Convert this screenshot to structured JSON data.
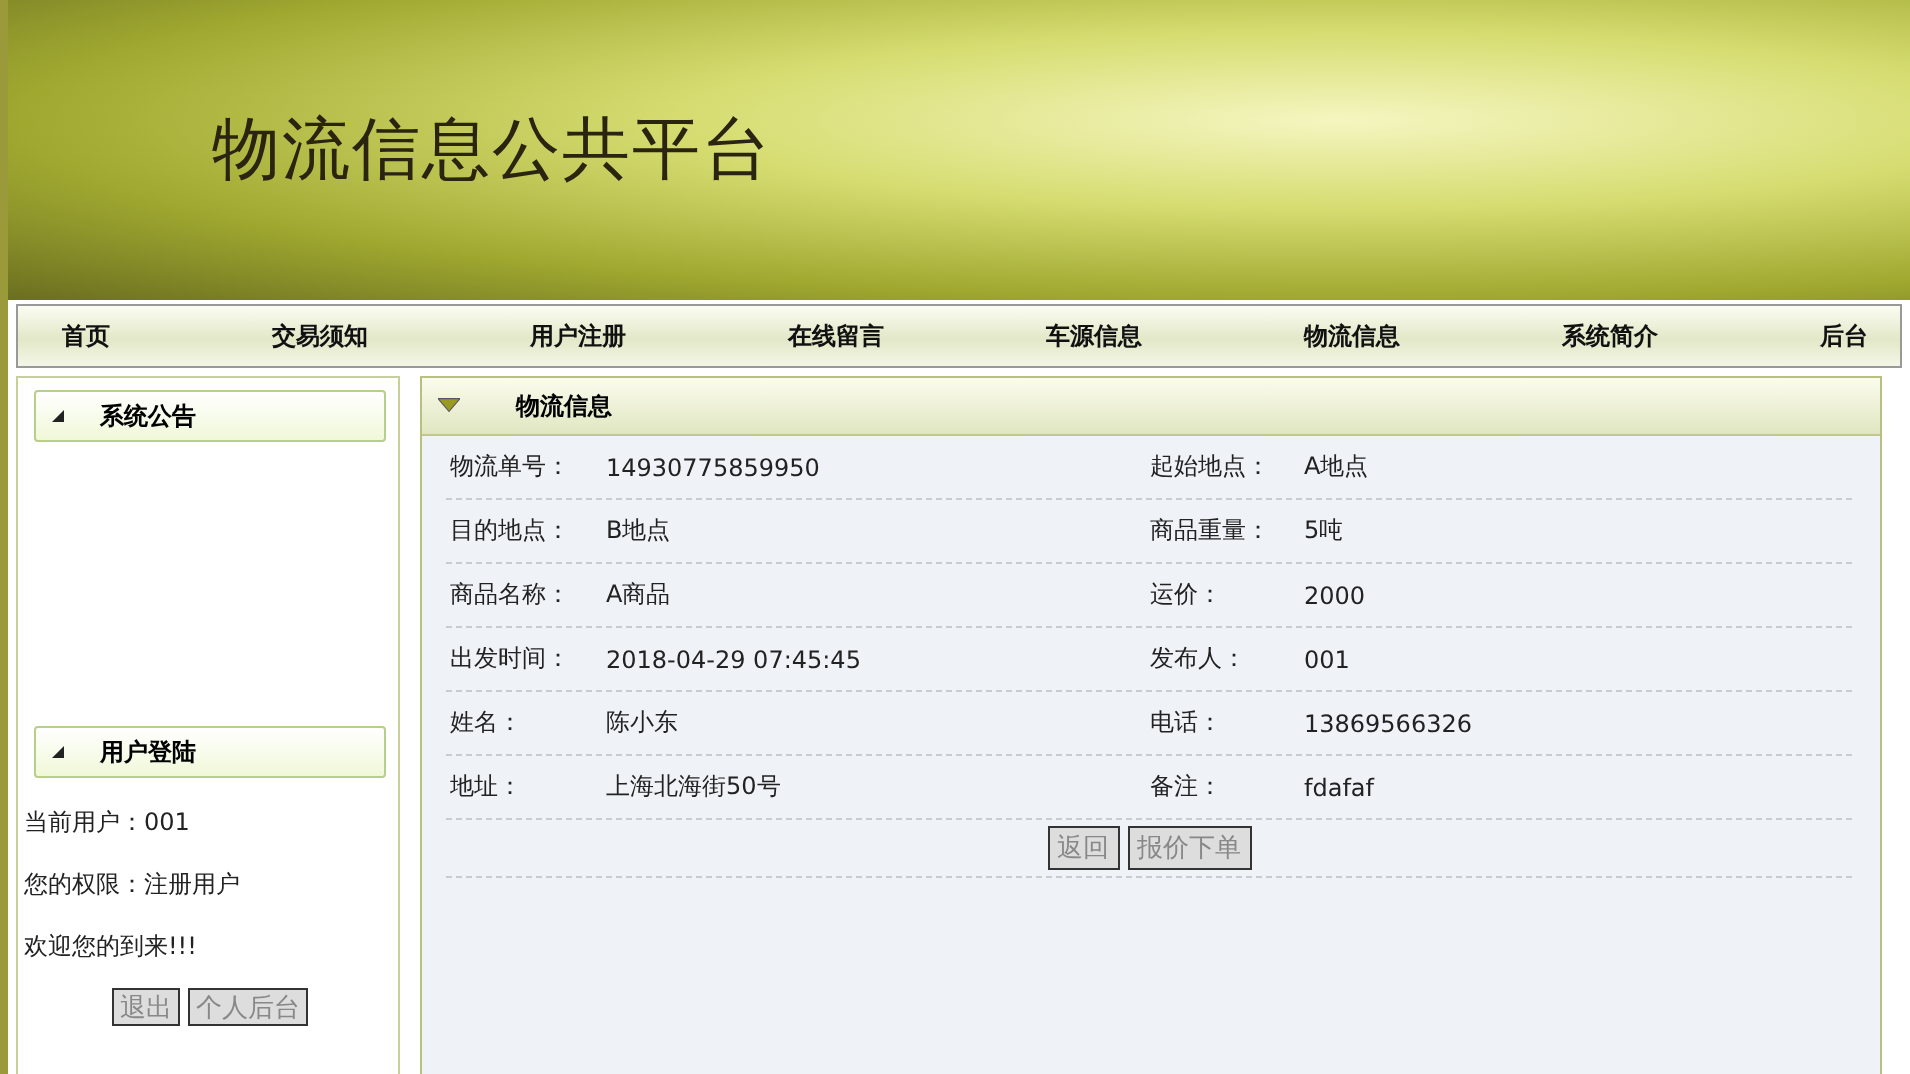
{
  "site_title": "物流信息公共平台",
  "nav": [
    "首页",
    "交易须知",
    "用户注册",
    "在线留言",
    "车源信息",
    "物流信息",
    "系统简介",
    "后台"
  ],
  "sidebar": {
    "notice_title": "系统公告",
    "login_title": "用户登陆",
    "user_lines": [
      "当前用户：001",
      "您的权限：注册用户",
      "欢迎您的到来!!!"
    ],
    "buttons": [
      "退出",
      "个人后台"
    ]
  },
  "panel": {
    "title": "物流信息",
    "rows": [
      {
        "label_1": "物流单号：",
        "value_1": "14930775859950",
        "label_2": "起始地点：",
        "value_2": "A地点"
      },
      {
        "label_1": "目的地点：",
        "value_1": "B地点",
        "label_2": "商品重量：",
        "value_2": "5吨"
      },
      {
        "label_1": "商品名称：",
        "value_1": "A商品",
        "label_2": "运价：",
        "value_2": "2000"
      },
      {
        "label_1": "出发时间：",
        "value_1": "2018-04-29 07:45:45",
        "label_2": "发布人：",
        "value_2": "001"
      },
      {
        "label_1": "姓名：",
        "value_1": "陈小东",
        "label_2": "电话：",
        "value_2": "13869566326"
      },
      {
        "label_1": "地址：",
        "value_1": "上海北海街50号",
        "label_2": "备注：",
        "value_2": "fdafaf"
      }
    ],
    "buttons": [
      "返回",
      "报价下单"
    ]
  }
}
